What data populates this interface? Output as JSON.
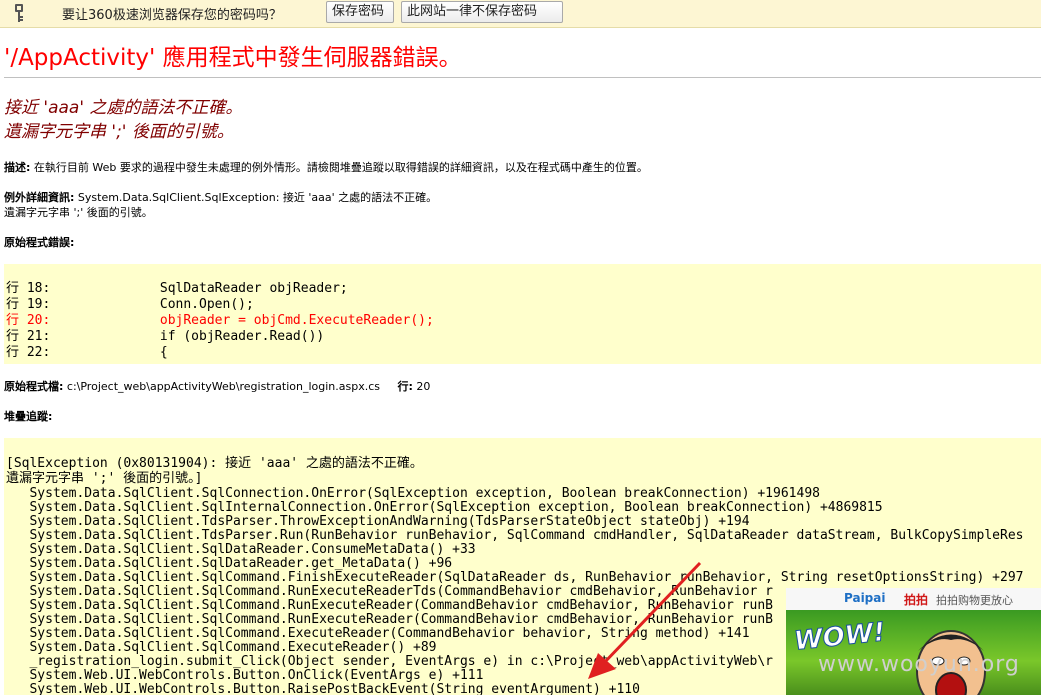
{
  "password_bar": {
    "message": "要让360极速浏览器保存您的密码吗？",
    "save_label": "保存密码",
    "never_label": "此网站一律不保存密码"
  },
  "page": {
    "title": "'/AppActivity' 應用程式中發生伺服器錯誤。",
    "error_message": [
      "接近 'aaa' 之處的語法不正確。",
      "遺漏字元字串 ';' 後面的引號。"
    ],
    "description_label": "描述:",
    "description_text": "在執行目前 Web 要求的過程中發生未處理的例外情形。請檢閱堆疊追蹤以取得錯誤的詳細資訊，以及在程式碼中產生的位置。",
    "exception_label": "例外詳細資訊:",
    "exception_text": "System.Data.SqlClient.SqlException: 接近 'aaa' 之處的語法不正確。",
    "exception_text2": "遺漏字元字串 ';' 後面的引號。",
    "source_error_label": "原始程式錯誤:",
    "source_lines": [
      "行 18:              SqlDataReader objReader;",
      "行 19:              Conn.Open();",
      "行 20:              objReader = objCmd.ExecuteReader();",
      "行 21:              if (objReader.Read())",
      "行 22:              {"
    ],
    "source_file_label": "原始程式檔:",
    "source_file": "c:\\Project_web\\appActivityWeb\\registration_login.aspx.cs",
    "line_label": "行:",
    "line_number": "20",
    "stack_trace_label": "堆疊追蹤:",
    "stack_lines": [
      "[SqlException (0x80131904): 接近 'aaa' 之處的語法不正確。",
      "遺漏字元字串 ';' 後面的引號。]",
      "   System.Data.SqlClient.SqlConnection.OnError(SqlException exception, Boolean breakConnection) +1961498",
      "   System.Data.SqlClient.SqlInternalConnection.OnError(SqlException exception, Boolean breakConnection) +4869815",
      "   System.Data.SqlClient.TdsParser.ThrowExceptionAndWarning(TdsParserStateObject stateObj) +194",
      "   System.Data.SqlClient.TdsParser.Run(RunBehavior runBehavior, SqlCommand cmdHandler, SqlDataReader dataStream, BulkCopySimpleRes",
      "   System.Data.SqlClient.SqlDataReader.ConsumeMetaData() +33",
      "   System.Data.SqlClient.SqlDataReader.get_MetaData() +96",
      "   System.Data.SqlClient.SqlCommand.FinishExecuteReader(SqlDataReader ds, RunBehavior runBehavior, String resetOptionsString) +297",
      "   System.Data.SqlClient.SqlCommand.RunExecuteReaderTds(CommandBehavior cmdBehavior, RunBehavior r",
      "   System.Data.SqlClient.SqlCommand.RunExecuteReader(CommandBehavior cmdBehavior, RunBehavior runB",
      "   System.Data.SqlClient.SqlCommand.RunExecuteReader(CommandBehavior cmdBehavior, RunBehavior runB",
      "   System.Data.SqlClient.SqlCommand.ExecuteReader(CommandBehavior behavior, String method) +141",
      "   System.Data.SqlClient.SqlCommand.ExecuteReader() +89",
      "   _registration_login.submit_Click(Object sender, EventArgs e) in c:\\Project_web\\appActivityWeb\\r",
      "   System.Web.UI.WebControls.Button.OnClick(EventArgs e) +111",
      "   System.Web.UI.WebControls.Button.RaisePostBackEvent(String eventArgument) +110"
    ]
  },
  "ad": {
    "brand": "Paipai",
    "brand_cn": "拍拍",
    "tagline": "拍拍购物更放心",
    "wow": "WOW!",
    "watermark": "www.wooyun.org"
  },
  "colors": {
    "title_red": "#ff0000",
    "error_maroon": "#800000",
    "code_bg": "#ffffcc",
    "bar_bg": "#fdf6d3"
  }
}
